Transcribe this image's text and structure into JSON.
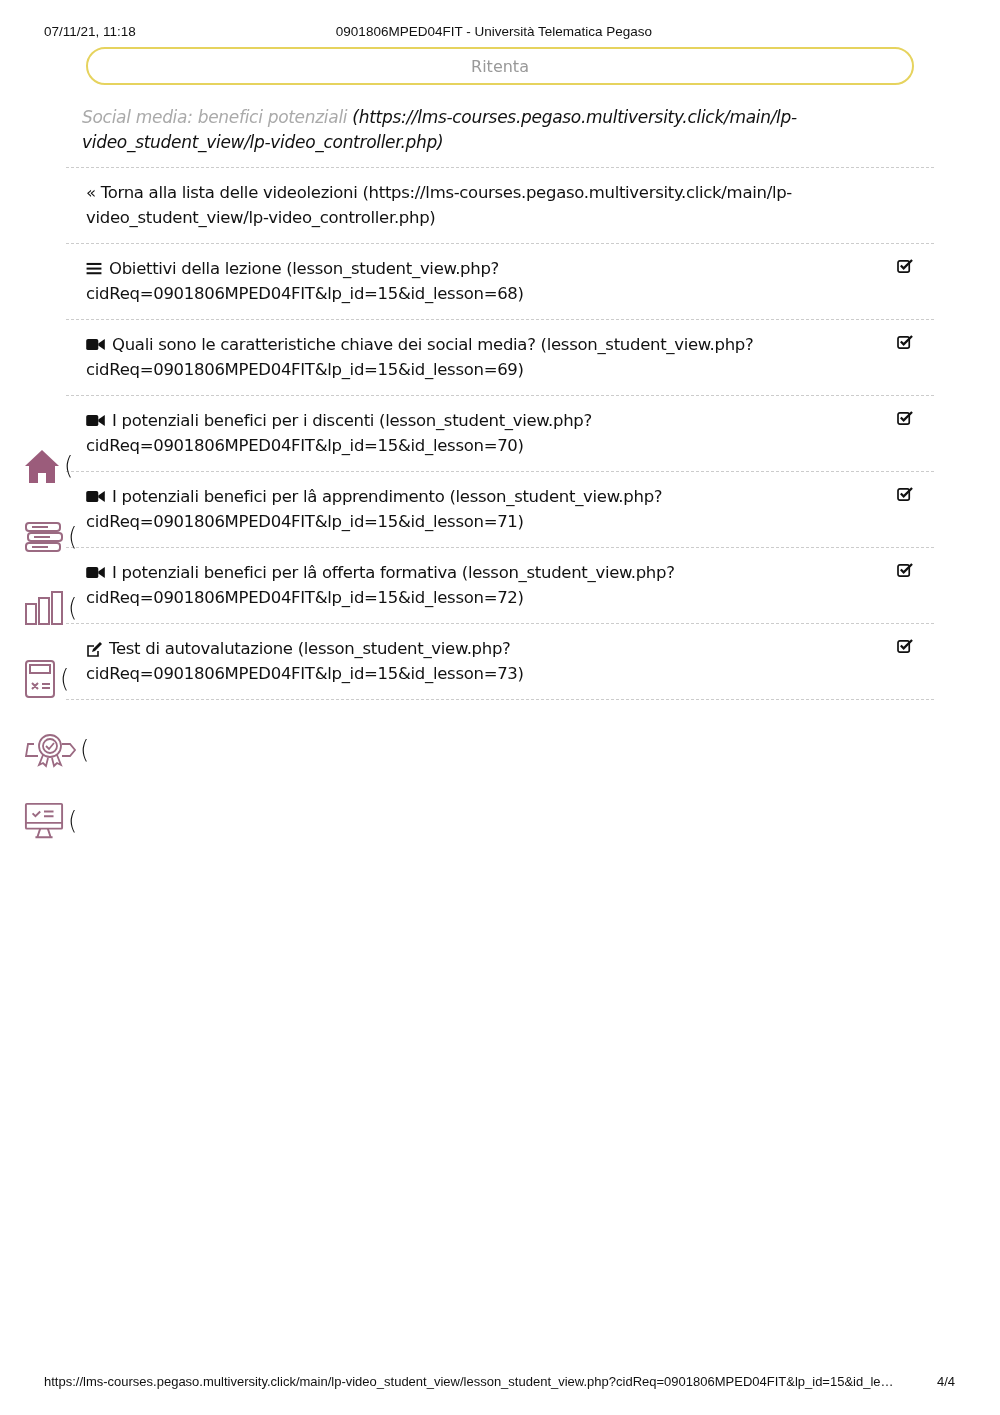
{
  "print_header": {
    "date": "07/11/21, 11:18",
    "title": "0901806MPED04FIT - Università Telematica Pegaso"
  },
  "retry_button": {
    "label": "Ritenta"
  },
  "lesson_link": {
    "title": "Social media: benefici potenziali",
    "url": "(https://lms-courses.pegaso.multiversity.click/main/lp-video_student_view/lp-video_controller.php)"
  },
  "back_link": {
    "icon": "«",
    "label": "Torna alla lista delle videolezioni (https://lms-courses.pegaso.multiversity.click/main/lp-video_student_view/lp-video_controller.php)"
  },
  "lessons": [
    {
      "kind": "list",
      "label": "Obiettivi della lezione (lesson_student_view.php?cidReq=0901806MPED04FIT&lp_id=15&id_lesson=68)",
      "checked": true
    },
    {
      "kind": "video",
      "label": "Quali sono le caratteristiche chiave dei social media? (lesson_student_view.php?cidReq=0901806MPED04FIT&lp_id=15&id_lesson=69)",
      "checked": true
    },
    {
      "kind": "video",
      "label": "I potenziali benefici per i discenti (lesson_student_view.php?cidReq=0901806MPED04FIT&lp_id=15&id_lesson=70)",
      "checked": true
    },
    {
      "kind": "video",
      "label": "I potenziali benefici per lâ   apprendimento (lesson_student_view.php?cidReq=0901806MPED04FIT&lp_id=15&id_lesson=71)",
      "checked": true
    },
    {
      "kind": "video",
      "label": "I potenziali benefici per lâ   offerta formativa (lesson_student_view.php?cidReq=0901806MPED04FIT&lp_id=15&id_lesson=72)",
      "checked": true
    },
    {
      "kind": "test",
      "label": "Test di autovalutazione (lesson_student_view.php?cidReq=0901806MPED04FIT&lp_id=15&id_lesson=73)",
      "checked": true
    }
  ],
  "side_menu": [
    {
      "kind": "home",
      "text": "("
    },
    {
      "kind": "books",
      "text": "("
    },
    {
      "kind": "chart",
      "text": "("
    },
    {
      "kind": "calculator",
      "text": "("
    },
    {
      "kind": "award",
      "text": "("
    },
    {
      "kind": "monitor",
      "text": "("
    }
  ],
  "print_footer": {
    "url": "https://lms-courses.pegaso.multiversity.click/main/lp-video_student_view/lesson_student_view.php?cidReq=0901806MPED04FIT&lp_id=15&id_le…",
    "page": "4/4"
  }
}
